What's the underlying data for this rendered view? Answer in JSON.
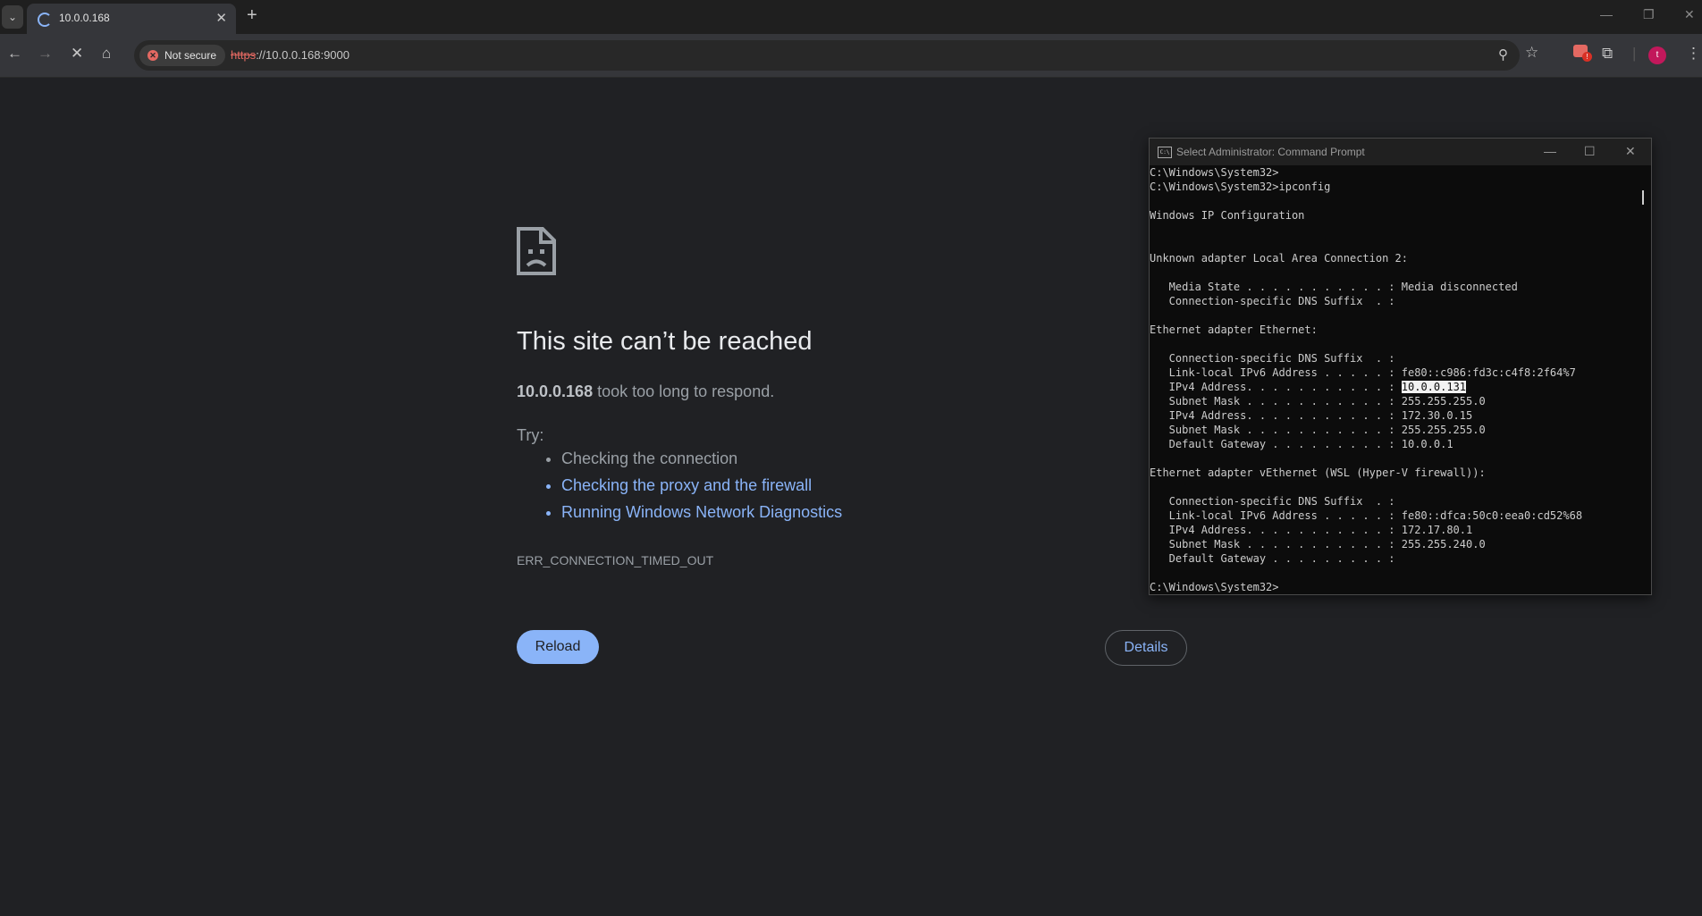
{
  "browser": {
    "tab_title": "10.0.0.168",
    "tab_close": "✕",
    "new_tab": "+",
    "url_scheme": "https",
    "url_rest": "://10.0.0.168:9000",
    "security_label": "Not secure",
    "avatar_initial": "t",
    "extension_badge": "!"
  },
  "error_page": {
    "title": "This site can’t be reached",
    "host": "10.0.0.168",
    "description": " took too long to respond.",
    "try_label": "Try:",
    "suggestions": [
      "Checking the connection",
      "Checking the proxy and the firewall",
      "Running Windows Network Diagnostics"
    ],
    "error_code": "ERR_CONNECTION_TIMED_OUT",
    "reload_label": "Reload",
    "details_label": "Details"
  },
  "cmd": {
    "title": "Select Administrator: Command Prompt",
    "lines": [
      "C:\\Windows\\System32>",
      "C:\\Windows\\System32>ipconfig",
      "",
      "Windows IP Configuration",
      "",
      "",
      "Unknown adapter Local Area Connection 2:",
      "",
      "   Media State . . . . . . . . . . . : Media disconnected",
      "   Connection-specific DNS Suffix  . :",
      "",
      "Ethernet adapter Ethernet:",
      "",
      "   Connection-specific DNS Suffix  . :",
      "   Link-local IPv6 Address . . . . . : fe80::c986:fd3c:c4f8:2f64%7",
      "   IPv4 Address. . . . . . . . . . . : ",
      "   Subnet Mask . . . . . . . . . . . : 255.255.255.0",
      "   IPv4 Address. . . . . . . . . . . : 172.30.0.15",
      "   Subnet Mask . . . . . . . . . . . : 255.255.255.0",
      "   Default Gateway . . . . . . . . . : 10.0.0.1",
      "",
      "Ethernet adapter vEthernet (WSL (Hyper-V firewall)):",
      "",
      "   Connection-specific DNS Suffix  . :",
      "   Link-local IPv6 Address . . . . . : fe80::dfca:50c0:eea0:cd52%68",
      "   IPv4 Address. . . . . . . . . . . : 172.17.80.1",
      "   Subnet Mask . . . . . . . . . . . : 255.255.240.0",
      "   Default Gateway . . . . . . . . . :",
      "",
      "C:\\Windows\\System32>"
    ],
    "selected_line_index": 15,
    "selected_text": "10.0.0.131"
  },
  "colors": {
    "page_bg": "#202124",
    "link": "#8ab4f8",
    "warning": "#e46962"
  }
}
